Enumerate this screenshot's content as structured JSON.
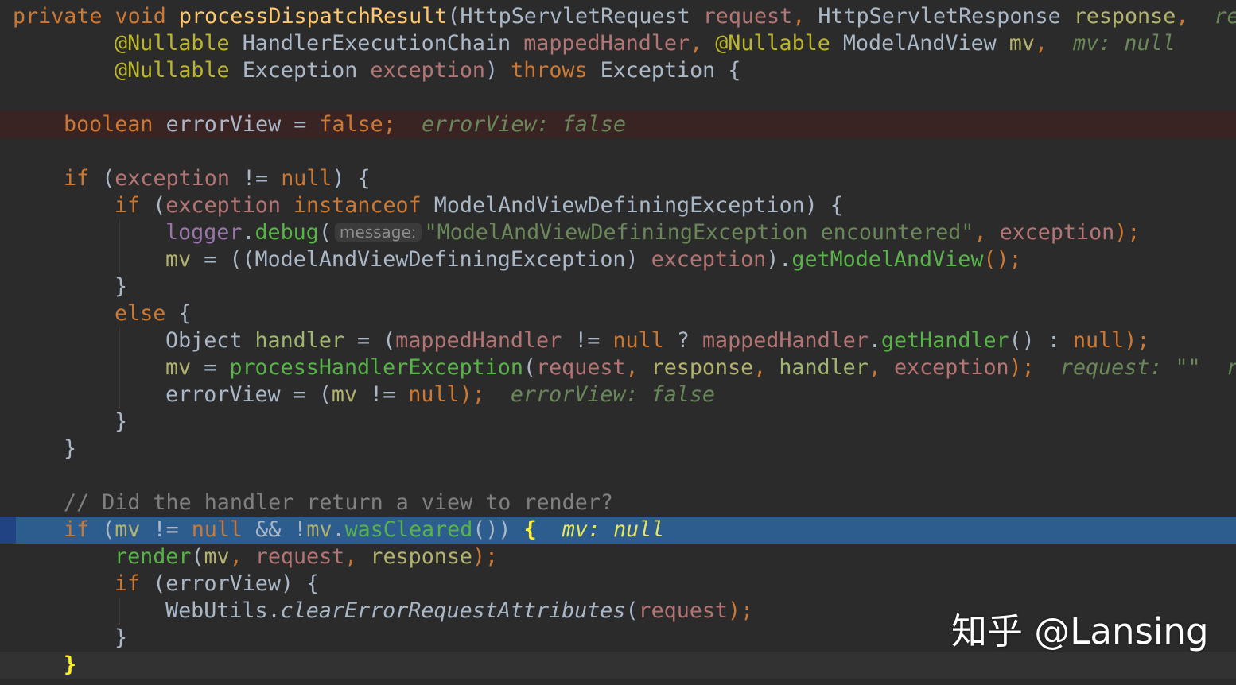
{
  "editor": {
    "lines": [
      {
        "tokens": [
          "private",
          "void",
          "processDispatchResult",
          "(",
          "HttpServletRequest",
          "request",
          ",",
          "HttpServletResponse",
          "response",
          ",",
          "re"
        ]
      },
      {
        "tokens": [
          "@Nullable",
          "HandlerExecutionChain",
          "mappedHandler",
          ",",
          "@Nullable",
          "ModelAndView",
          "mv",
          ",",
          "mv: null"
        ]
      },
      {
        "tokens": [
          "@Nullable",
          "Exception",
          "exception",
          ")",
          "throws",
          "Exception",
          "{"
        ]
      },
      {
        "tokens": []
      },
      {
        "tokens": [
          "boolean",
          "errorView",
          "=",
          "false",
          ";",
          "errorView: false"
        ]
      },
      {
        "tokens": []
      },
      {
        "tokens": [
          "if",
          "(",
          "exception",
          "!=",
          "null",
          ")",
          "{"
        ]
      },
      {
        "tokens": [
          "if",
          "(",
          "exception",
          "instanceof",
          "ModelAndViewDefiningException",
          ")",
          "{"
        ]
      },
      {
        "tokens": [
          "logger",
          ".",
          "debug",
          "(",
          "message:",
          "\"ModelAndViewDefiningException encountered\"",
          ",",
          "exception",
          ");"
        ]
      },
      {
        "tokens": [
          "mv",
          "=",
          "((",
          "ModelAndViewDefiningException",
          ")",
          "exception",
          ").",
          "getModelAndView",
          "();"
        ]
      },
      {
        "tokens": [
          "}"
        ]
      },
      {
        "tokens": [
          "else",
          "{"
        ]
      },
      {
        "tokens": [
          "Object",
          "handler",
          "=",
          "(",
          "mappedHandler",
          "!=",
          "null",
          "?",
          "mappedHandler",
          ".",
          "getHandler",
          "()",
          ":",
          "null",
          ");"
        ]
      },
      {
        "tokens": [
          "mv",
          "=",
          "processHandlerException",
          "(",
          "request",
          ",",
          "response",
          ",",
          "handler",
          ",",
          "exception",
          ");",
          "request: \"\"",
          "r"
        ]
      },
      {
        "tokens": [
          "errorView",
          "=",
          "(",
          "mv",
          "!=",
          "null",
          ");",
          "errorView: false"
        ]
      },
      {
        "tokens": [
          "}"
        ]
      },
      {
        "tokens": [
          "}"
        ]
      },
      {
        "tokens": []
      },
      {
        "tokens": [
          "// Did the handler return a view to render?"
        ]
      },
      {
        "tokens": [
          "if",
          "(",
          "mv",
          "!=",
          "null",
          "&&",
          "!",
          "mv",
          ".",
          "wasCleared",
          "())",
          "{",
          "mv: null"
        ]
      },
      {
        "tokens": [
          "render",
          "(",
          "mv",
          ",",
          "request",
          ",",
          "response",
          ");"
        ]
      },
      {
        "tokens": [
          "if",
          "(",
          "errorView",
          ")",
          "{"
        ]
      },
      {
        "tokens": [
          "WebUtils",
          ".",
          "clearErrorRequestAttributes",
          "(",
          "request",
          ");"
        ]
      },
      {
        "tokens": [
          "}"
        ]
      },
      {
        "tokens": [
          "}"
        ]
      }
    ]
  },
  "watermark": {
    "text": "知乎 @Lansing"
  },
  "colors": {
    "background": "#2b2b2b",
    "keyword": "#cc7832",
    "method_declaration": "#ffc66d",
    "annotation": "#bbb529",
    "parameter": "#b57474",
    "field": "#9876aa",
    "method_call": "#58b348",
    "string": "#6a8759",
    "comment": "#808080",
    "debug_hint": "#6a8759",
    "breakpoint_line": "#3a2323",
    "execution_line": "#2d5c8f"
  }
}
